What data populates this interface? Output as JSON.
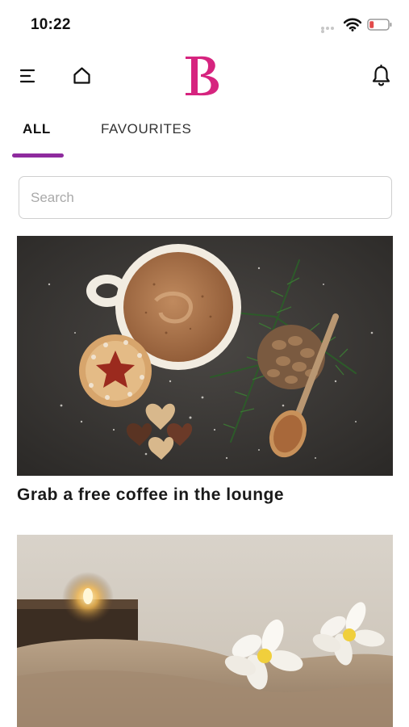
{
  "status_bar": {
    "time": "10:22",
    "icons": [
      "signal-dots-icon",
      "wifi-icon",
      "battery-low-icon"
    ],
    "battery_color": "#e24a4a"
  },
  "header": {
    "menu_icon": "menu-icon",
    "home_icon": "home-icon",
    "logo_letter": "B",
    "logo_color": "#d6247f",
    "bell_icon": "bell-icon"
  },
  "tabs": {
    "items": [
      {
        "label": "ALL",
        "active": true
      },
      {
        "label": "FAVOURITES",
        "active": false
      }
    ],
    "indicator_color": "#8e2b9e"
  },
  "search": {
    "placeholder": "Search",
    "value": ""
  },
  "cards": [
    {
      "title": "Grab a free coffee in the lounge",
      "image": "coffee-cup-with-cookies-and-pine-cone-photo"
    },
    {
      "title": "",
      "image": "spa-towel-with-frangipani-flowers-and-candle-photo"
    }
  ]
}
